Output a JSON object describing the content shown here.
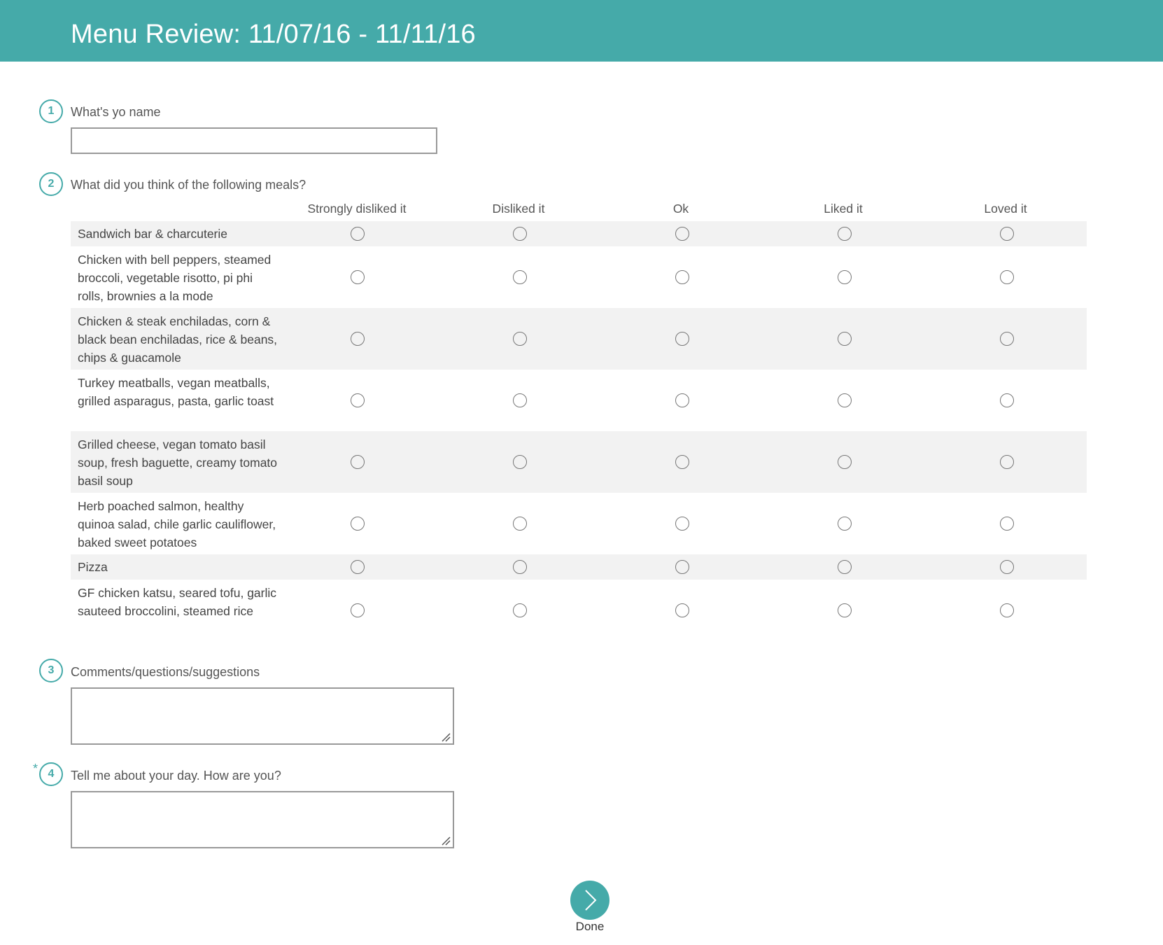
{
  "header": {
    "title": "Menu Review: 11/07/16 - 11/11/16",
    "color": "#45aaa9"
  },
  "questions": [
    {
      "number": "1",
      "label": "What's yo name",
      "input_value": "",
      "required": false
    },
    {
      "number": "2",
      "label": "What did you think of the following meals?",
      "required": false
    },
    {
      "number": "3",
      "label": "Comments/questions/suggestions",
      "input_value": "",
      "required": false
    },
    {
      "number": "4",
      "label": "Tell me about your day.  How are you?",
      "input_value": "",
      "required": true,
      "required_mark": "*"
    }
  ],
  "matrix": {
    "columns": [
      "Strongly disliked it",
      "Disliked it",
      "Ok",
      "Liked it",
      "Loved it"
    ],
    "rows": [
      {
        "label": "Sandwich bar & charcuterie",
        "selected": null
      },
      {
        "label": "Chicken with bell peppers, steamed broccoli, vegetable risotto, pi phi rolls, brownies a la mode",
        "selected": null
      },
      {
        "label": "Chicken & steak enchiladas, corn & black bean enchiladas, rice & beans, chips & guacamole",
        "selected": null
      },
      {
        "label": "Turkey meatballs, vegan meatballs, grilled asparagus, pasta, garlic toast",
        "selected": null
      },
      {
        "label": "Grilled cheese, vegan tomato basil soup, fresh baguette, creamy tomato basil soup",
        "selected": null
      },
      {
        "label": "Herb poached salmon, healthy quinoa salad, chile garlic cauliflower, baked sweet potatoes",
        "selected": null
      },
      {
        "label": "Pizza",
        "selected": null
      },
      {
        "label": "GF chicken katsu, seared tofu, garlic sauteed broccolini, steamed rice",
        "selected": null
      }
    ]
  },
  "done": {
    "label": "Done",
    "icon": "chevron-right-icon"
  }
}
